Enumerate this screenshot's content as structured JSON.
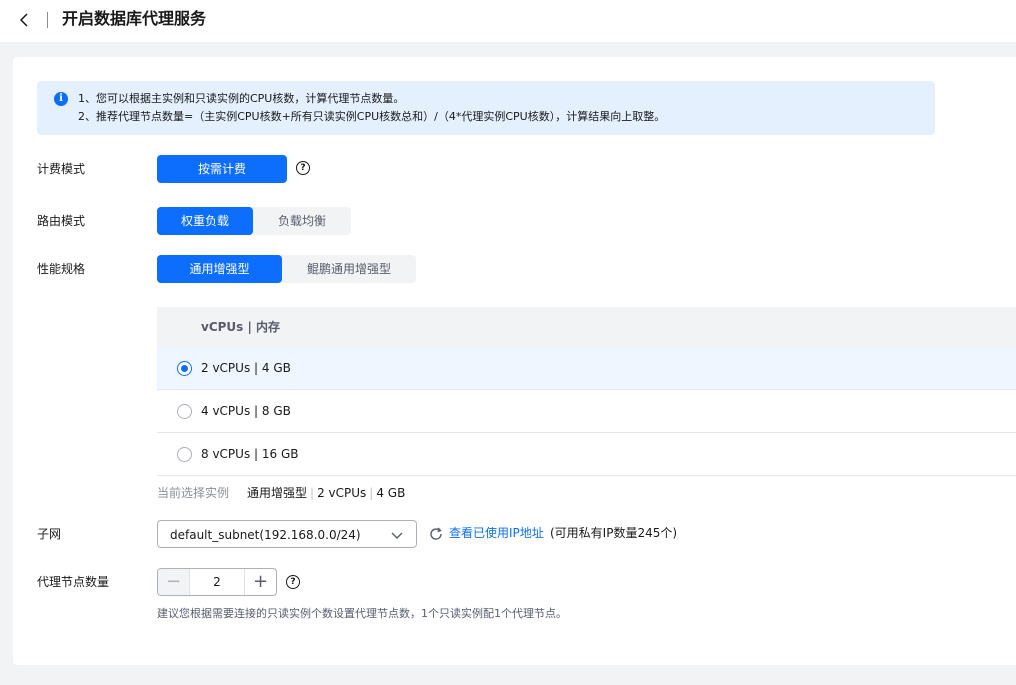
{
  "header": {
    "title": "开启数据库代理服务"
  },
  "notice": {
    "line1": "1、您可以根据主实例和只读实例的CPU核数，计算代理节点数量。",
    "line2": "2、推荐代理节点数量=（主实例CPU核数+所有只读实例CPU核数总和）/（4*代理实例CPU核数），计算结果向上取整。"
  },
  "billing": {
    "label": "计费模式",
    "option": "按需计费"
  },
  "routing": {
    "label": "路由模式",
    "options": [
      "权重负载",
      "负载均衡"
    ],
    "selected": 0
  },
  "spec": {
    "label": "性能规格",
    "options": [
      "通用增强型",
      "鲲鹏通用增强型"
    ],
    "selected": 0
  },
  "table": {
    "header": "vCPUs | 内存",
    "rows": [
      "2 vCPUs | 4 GB",
      "4 vCPUs | 8 GB",
      "8 vCPUs | 16 GB"
    ],
    "selected": 0
  },
  "current": {
    "label": "当前选择实例",
    "type": "通用增强型",
    "cpu": "2 vCPUs",
    "mem": "4 GB"
  },
  "subnet": {
    "label": "子网",
    "value": "default_subnet(192.168.0.0/24)",
    "link": "查看已使用IP地址",
    "info": "(可用私有IP数量245个)"
  },
  "nodes": {
    "label": "代理节点数量",
    "value": "2",
    "hint": "建议您根据需要连接的只读实例个数设置代理节点数，1个只读实例配1个代理节点。"
  },
  "colors": {
    "primary": "#0d6efd",
    "notice_bg": "#e5f0ff",
    "page_bg": "#f2f3f5"
  }
}
